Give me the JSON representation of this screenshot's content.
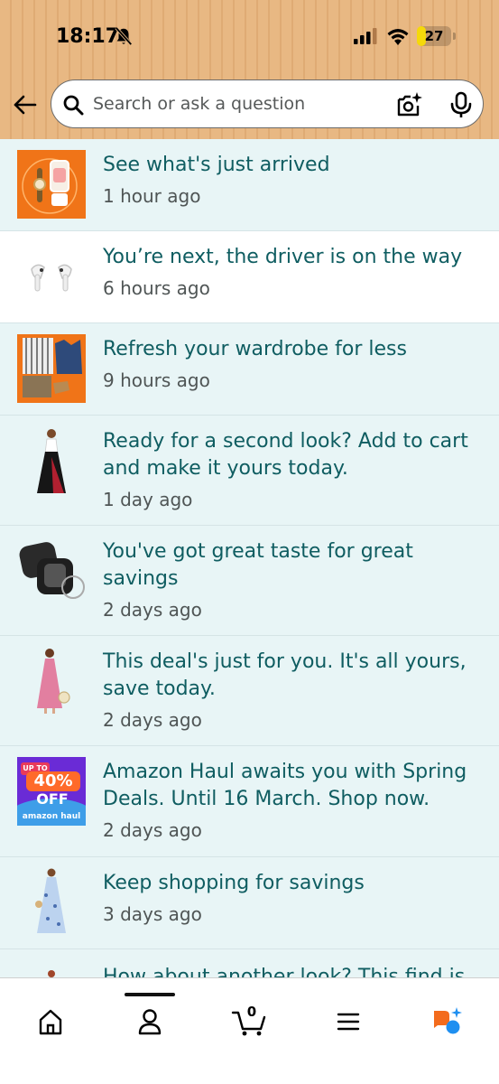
{
  "status_bar": {
    "time": "18:17",
    "battery_level": "27",
    "battery_fraction": 0.27,
    "battery_color": "#f5d90a"
  },
  "search": {
    "placeholder": "Search or ask a question"
  },
  "notifications": [
    {
      "title": "See what's just arrived",
      "time": "1 hour ago",
      "unread": true,
      "thumb": "blender-watch-icon"
    },
    {
      "title": "You’re next, the driver is on the way",
      "time": "6 hours ago",
      "unread": false,
      "thumb": "earbuds-icon"
    },
    {
      "title": "Refresh your wardrobe for less",
      "time": "9 hours ago",
      "unread": true,
      "thumb": "clothing-icon"
    },
    {
      "title": "Ready for a second look? Add to cart and make it yours today.",
      "time": "1 day ago",
      "unread": true,
      "thumb": "dress-black-icon"
    },
    {
      "title": "You've got great taste for great savings",
      "time": "2 days ago",
      "unread": true,
      "thumb": "earbuds-case-icon"
    },
    {
      "title": "This deal's just for you. It's all yours, save today.",
      "time": "2 days ago",
      "unread": true,
      "thumb": "dress-pink-icon"
    },
    {
      "title": "Amazon Haul awaits you with Spring Deals. Until 16 March. Shop now.",
      "time": "2 days ago",
      "unread": true,
      "thumb": "amazon-haul-icon",
      "badge": {
        "upto": "UP TO",
        "percent": "40%",
        "off": "OFF",
        "brand": "amazon haul"
      }
    },
    {
      "title": "Keep shopping for savings",
      "time": "3 days ago",
      "unread": true,
      "thumb": "dress-floral-icon"
    },
    {
      "title": "How about another look? This find is",
      "time": "",
      "unread": true,
      "thumb": "dress-red-icon"
    }
  ],
  "bottom_nav": {
    "items": [
      "home-icon",
      "account-icon",
      "cart-icon",
      "menu-icon",
      "rufus-icon"
    ],
    "cart_count": "0"
  },
  "colors": {
    "header": "#e8b883",
    "unread_bg": "#e8f5f6",
    "title_text": "#0f5d61",
    "thumb_orange": "#f07418",
    "haul_purple": "#6a2bd6"
  }
}
